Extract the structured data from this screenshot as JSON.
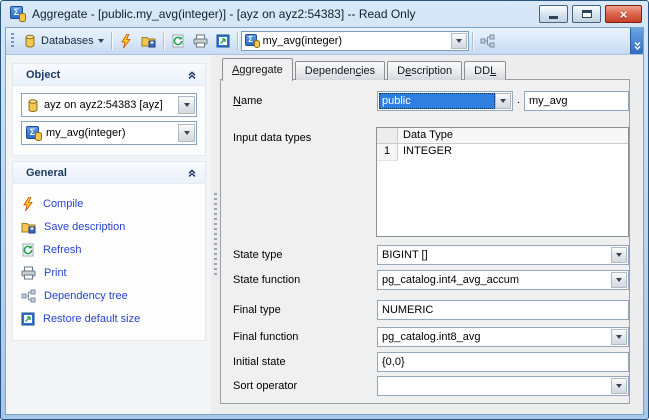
{
  "window": {
    "title": "Aggregate - [public.my_avg(integer)] - [ayz on ayz2:54383]  -- Read Only"
  },
  "icons": {
    "sigma_glyph": "Σ",
    "close_glyph": "×"
  },
  "toolbar": {
    "databases_label": "Databases",
    "object_combo_value": "my_avg(integer)"
  },
  "sidebar": {
    "object_panel": {
      "title": "Object",
      "database_combo_value": "ayz on ayz2:54383 [ayz]",
      "object_combo_value": "my_avg(integer)"
    },
    "general_panel": {
      "title": "General",
      "links": [
        {
          "label": "Compile"
        },
        {
          "label": "Save description"
        },
        {
          "label": "Refresh"
        },
        {
          "label": "Print"
        },
        {
          "label": "Dependency tree"
        },
        {
          "label": "Restore default size"
        }
      ]
    }
  },
  "main": {
    "tabs": [
      {
        "pre": "",
        "key": "A",
        "post": "ggregate"
      },
      {
        "pre": "Dependen",
        "key": "c",
        "post": "ies"
      },
      {
        "pre": "D",
        "key": "e",
        "post": "scription"
      },
      {
        "pre": "DD",
        "key": "L",
        "post": ""
      }
    ],
    "form": {
      "name_label": {
        "pre": "",
        "key": "N",
        "post": "ame"
      },
      "schema_value": "public",
      "name_separator": ".",
      "name_value": "my_avg",
      "input_types_label": "Input data types",
      "table": {
        "columns": [
          "",
          "Data Type"
        ],
        "rows": [
          [
            "1",
            "INTEGER"
          ]
        ]
      },
      "fields": [
        {
          "label": "State type",
          "value": "BIGINT []"
        },
        {
          "label": "State function",
          "value": "pg_catalog.int4_avg_accum"
        },
        {
          "label": "Final type",
          "value": "NUMERIC"
        },
        {
          "label": "Final function",
          "value": "pg_catalog.int8_avg"
        },
        {
          "label": "Initial state",
          "value": "{0,0}"
        },
        {
          "label": "Sort operator",
          "value": ""
        }
      ]
    }
  }
}
